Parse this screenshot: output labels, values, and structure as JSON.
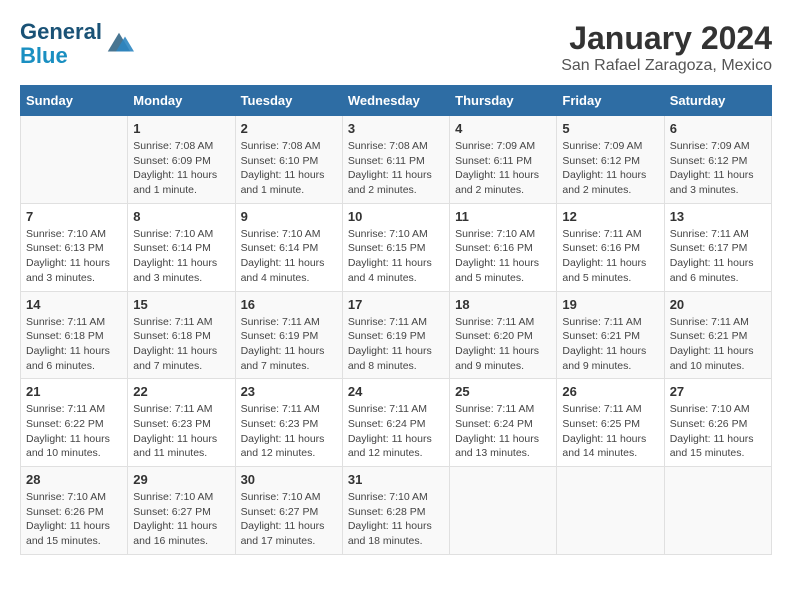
{
  "header": {
    "logo_line1": "General",
    "logo_line2": "Blue",
    "month": "January 2024",
    "location": "San Rafael Zaragoza, Mexico"
  },
  "weekdays": [
    "Sunday",
    "Monday",
    "Tuesday",
    "Wednesday",
    "Thursday",
    "Friday",
    "Saturday"
  ],
  "weeks": [
    [
      {
        "day": "",
        "info": ""
      },
      {
        "day": "1",
        "info": "Sunrise: 7:08 AM\nSunset: 6:09 PM\nDaylight: 11 hours\nand 1 minute."
      },
      {
        "day": "2",
        "info": "Sunrise: 7:08 AM\nSunset: 6:10 PM\nDaylight: 11 hours\nand 1 minute."
      },
      {
        "day": "3",
        "info": "Sunrise: 7:08 AM\nSunset: 6:11 PM\nDaylight: 11 hours\nand 2 minutes."
      },
      {
        "day": "4",
        "info": "Sunrise: 7:09 AM\nSunset: 6:11 PM\nDaylight: 11 hours\nand 2 minutes."
      },
      {
        "day": "5",
        "info": "Sunrise: 7:09 AM\nSunset: 6:12 PM\nDaylight: 11 hours\nand 2 minutes."
      },
      {
        "day": "6",
        "info": "Sunrise: 7:09 AM\nSunset: 6:12 PM\nDaylight: 11 hours\nand 3 minutes."
      }
    ],
    [
      {
        "day": "7",
        "info": "Sunrise: 7:10 AM\nSunset: 6:13 PM\nDaylight: 11 hours\nand 3 minutes."
      },
      {
        "day": "8",
        "info": "Sunrise: 7:10 AM\nSunset: 6:14 PM\nDaylight: 11 hours\nand 3 minutes."
      },
      {
        "day": "9",
        "info": "Sunrise: 7:10 AM\nSunset: 6:14 PM\nDaylight: 11 hours\nand 4 minutes."
      },
      {
        "day": "10",
        "info": "Sunrise: 7:10 AM\nSunset: 6:15 PM\nDaylight: 11 hours\nand 4 minutes."
      },
      {
        "day": "11",
        "info": "Sunrise: 7:10 AM\nSunset: 6:16 PM\nDaylight: 11 hours\nand 5 minutes."
      },
      {
        "day": "12",
        "info": "Sunrise: 7:11 AM\nSunset: 6:16 PM\nDaylight: 11 hours\nand 5 minutes."
      },
      {
        "day": "13",
        "info": "Sunrise: 7:11 AM\nSunset: 6:17 PM\nDaylight: 11 hours\nand 6 minutes."
      }
    ],
    [
      {
        "day": "14",
        "info": "Sunrise: 7:11 AM\nSunset: 6:18 PM\nDaylight: 11 hours\nand 6 minutes."
      },
      {
        "day": "15",
        "info": "Sunrise: 7:11 AM\nSunset: 6:18 PM\nDaylight: 11 hours\nand 7 minutes."
      },
      {
        "day": "16",
        "info": "Sunrise: 7:11 AM\nSunset: 6:19 PM\nDaylight: 11 hours\nand 7 minutes."
      },
      {
        "day": "17",
        "info": "Sunrise: 7:11 AM\nSunset: 6:19 PM\nDaylight: 11 hours\nand 8 minutes."
      },
      {
        "day": "18",
        "info": "Sunrise: 7:11 AM\nSunset: 6:20 PM\nDaylight: 11 hours\nand 9 minutes."
      },
      {
        "day": "19",
        "info": "Sunrise: 7:11 AM\nSunset: 6:21 PM\nDaylight: 11 hours\nand 9 minutes."
      },
      {
        "day": "20",
        "info": "Sunrise: 7:11 AM\nSunset: 6:21 PM\nDaylight: 11 hours\nand 10 minutes."
      }
    ],
    [
      {
        "day": "21",
        "info": "Sunrise: 7:11 AM\nSunset: 6:22 PM\nDaylight: 11 hours\nand 10 minutes."
      },
      {
        "day": "22",
        "info": "Sunrise: 7:11 AM\nSunset: 6:23 PM\nDaylight: 11 hours\nand 11 minutes."
      },
      {
        "day": "23",
        "info": "Sunrise: 7:11 AM\nSunset: 6:23 PM\nDaylight: 11 hours\nand 12 minutes."
      },
      {
        "day": "24",
        "info": "Sunrise: 7:11 AM\nSunset: 6:24 PM\nDaylight: 11 hours\nand 12 minutes."
      },
      {
        "day": "25",
        "info": "Sunrise: 7:11 AM\nSunset: 6:24 PM\nDaylight: 11 hours\nand 13 minutes."
      },
      {
        "day": "26",
        "info": "Sunrise: 7:11 AM\nSunset: 6:25 PM\nDaylight: 11 hours\nand 14 minutes."
      },
      {
        "day": "27",
        "info": "Sunrise: 7:10 AM\nSunset: 6:26 PM\nDaylight: 11 hours\nand 15 minutes."
      }
    ],
    [
      {
        "day": "28",
        "info": "Sunrise: 7:10 AM\nSunset: 6:26 PM\nDaylight: 11 hours\nand 15 minutes."
      },
      {
        "day": "29",
        "info": "Sunrise: 7:10 AM\nSunset: 6:27 PM\nDaylight: 11 hours\nand 16 minutes."
      },
      {
        "day": "30",
        "info": "Sunrise: 7:10 AM\nSunset: 6:27 PM\nDaylight: 11 hours\nand 17 minutes."
      },
      {
        "day": "31",
        "info": "Sunrise: 7:10 AM\nSunset: 6:28 PM\nDaylight: 11 hours\nand 18 minutes."
      },
      {
        "day": "",
        "info": ""
      },
      {
        "day": "",
        "info": ""
      },
      {
        "day": "",
        "info": ""
      }
    ]
  ]
}
